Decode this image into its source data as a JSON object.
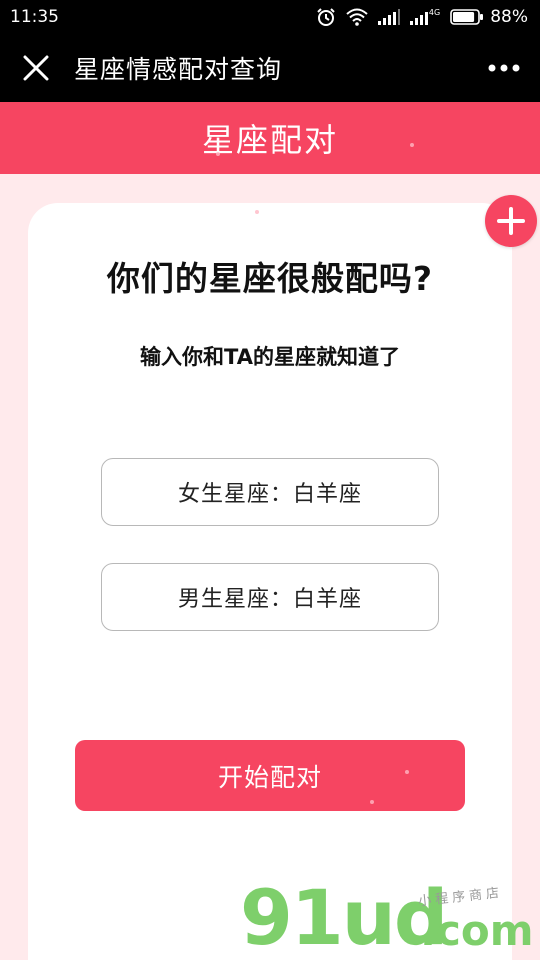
{
  "status_bar": {
    "time": "11:35",
    "network_label": "4G",
    "battery_percent": "88%",
    "battery_level": 0.88
  },
  "title_bar": {
    "title": "星座情感配对查询",
    "close_icon": "close-icon",
    "more_icon": "more-icon"
  },
  "header": {
    "title": "星座配对"
  },
  "card": {
    "question": "你们的星座很般配吗?",
    "subtitle": "输入你和TA的星座就知道了",
    "female_select": "女生星座：白羊座",
    "male_select": "男生星座：白羊座",
    "start_button": "开始配对",
    "fab_icon": "plus-icon"
  },
  "watermark": {
    "main": "91ud",
    "domain": ".com",
    "tagline": "小程序商店"
  },
  "colors": {
    "accent": "#f64561",
    "background": "#ffeaec",
    "watermark_green": "#7ecf6b"
  }
}
